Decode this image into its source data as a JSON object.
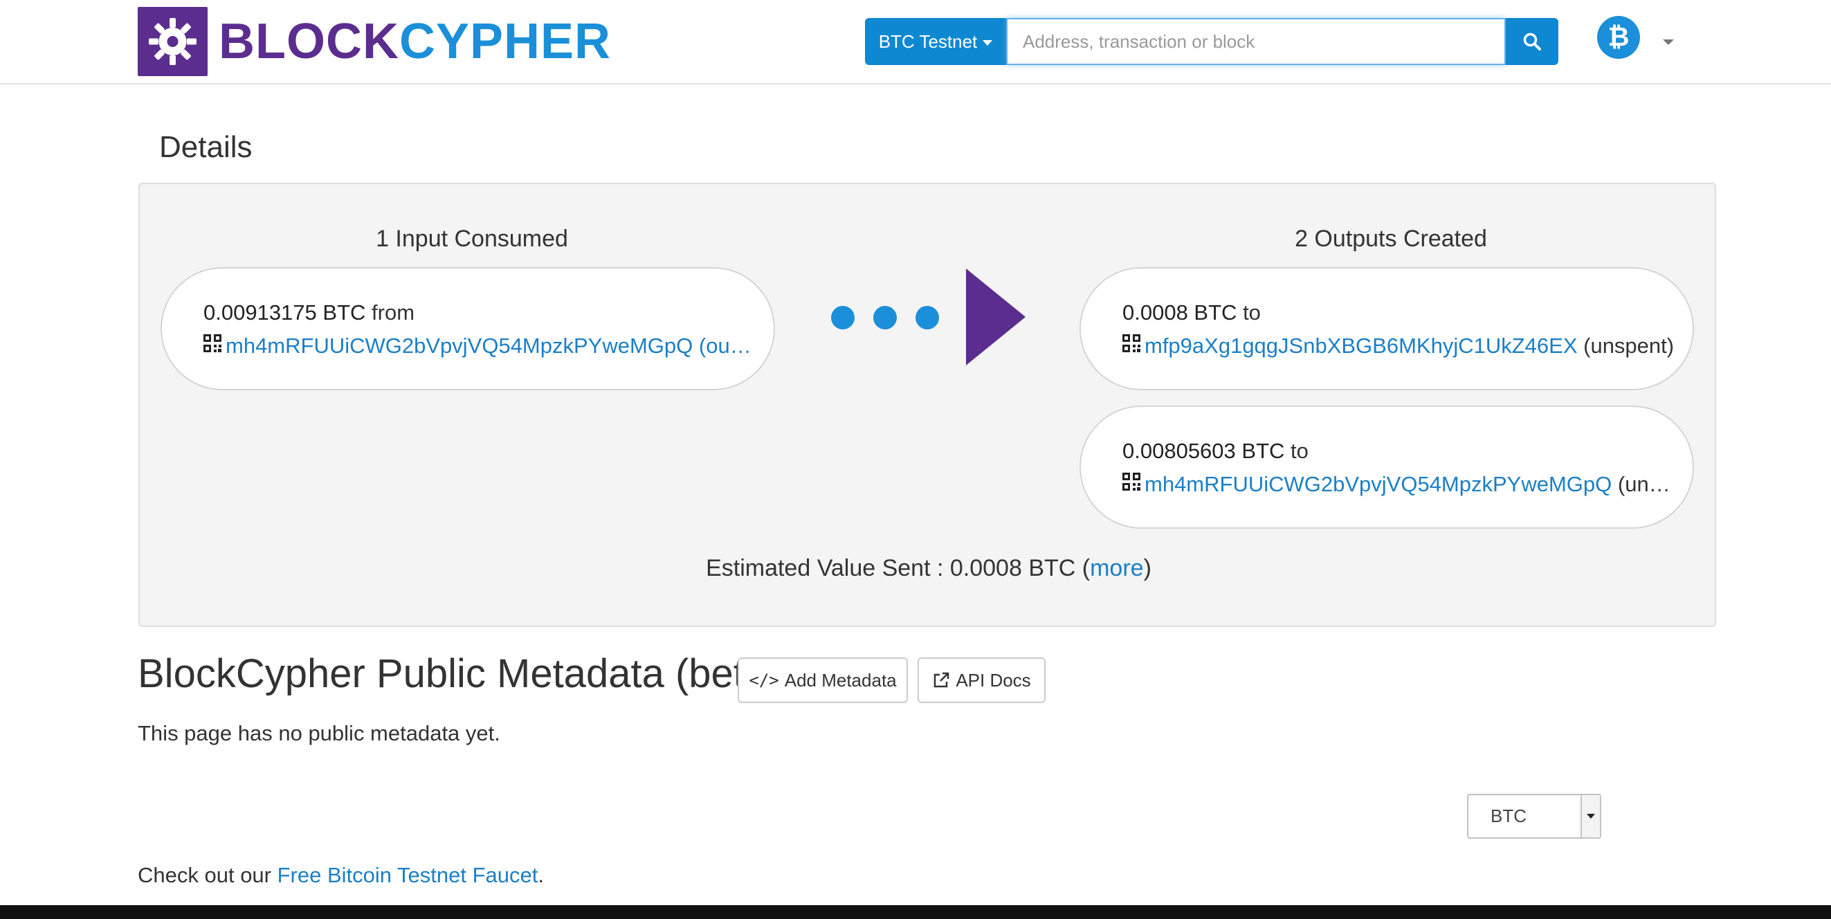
{
  "brand": {
    "part1": "BLOCK",
    "part2": "CYPHER",
    "purple": "#5b2d8e",
    "blue": "#1b8fd9"
  },
  "search": {
    "network_label": "BTC Testnet",
    "placeholder": "Address, transaction or block",
    "button_icon": "search-icon"
  },
  "user_menu": {
    "coin_symbol": "₿",
    "icon": "bitcoin-icon"
  },
  "details": {
    "title": "Details",
    "inputs_title": "1 Input Consumed",
    "outputs_title": "2 Outputs Created",
    "inputs": [
      {
        "amount": "0.00913175 BTC",
        "direction": "from",
        "address": "mh4mRFUUiCWG2bVpvjVQ54MpzkPYweMGpQ",
        "status": "(ou…"
      }
    ],
    "outputs": [
      {
        "amount": "0.0008 BTC",
        "direction": "to",
        "address": "mfp9aXg1gqgJSnbXBGB6MKhyjC1UkZ46EX",
        "status": "(unspent)"
      },
      {
        "amount": "0.00805603 BTC",
        "direction": "to",
        "address": "mh4mRFUUiCWG2bVpvjVQ54MpzkPYweMGpQ",
        "status": "(un…"
      }
    ],
    "estimated": {
      "label": "Estimated Value Sent",
      "separator": " : ",
      "value": "0.0008 BTC",
      "open_paren": " (",
      "link": "more",
      "close_paren": ")"
    }
  },
  "metadata": {
    "title": "BlockCypher Public Metadata (beta)",
    "add_button": "Add Metadata",
    "docs_button": "API Docs",
    "note": "This page has no public metadata yet."
  },
  "unit_select": {
    "value": "BTC"
  },
  "faucet": {
    "prefix": "Check out our ",
    "link": "Free Bitcoin Testnet Faucet",
    "suffix": "."
  }
}
